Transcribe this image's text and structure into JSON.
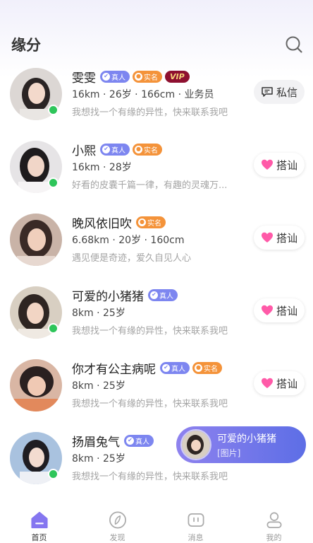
{
  "header": {
    "title": "缘分",
    "search_icon": "search-icon"
  },
  "users": [
    {
      "name": "雯雯",
      "badges": [
        "真人",
        "实名",
        "VIP"
      ],
      "info": "16km · 26岁 · 166cm · 业务员",
      "desc": "我想找一个有缘的异性，快来联系我吧",
      "online": true,
      "action": "私信",
      "action_icon": "message-icon"
    },
    {
      "name": "小熙",
      "badges": [
        "真人",
        "实名"
      ],
      "info": "16km · 28岁",
      "desc": "好看的皮囊千篇一律，有趣的灵魂万...",
      "online": true,
      "action": "搭讪",
      "action_icon": "heart-icon"
    },
    {
      "name": "晚风依旧吹",
      "badges": [
        "实名"
      ],
      "info": "6.68km · 20岁 · 160cm",
      "desc": "遇见便是奇迹，爱久自见人心",
      "online": false,
      "action": "搭讪",
      "action_icon": "heart-icon"
    },
    {
      "name": "可爱的小猪猪",
      "badges": [
        "真人"
      ],
      "info": "8km · 25岁",
      "desc": "我想找一个有缘的异性，快来联系我吧",
      "online": true,
      "action": "搭讪",
      "action_icon": "heart-icon"
    },
    {
      "name": "你才有公主病呢",
      "badges": [
        "真人",
        "实名"
      ],
      "info": "8km · 25岁",
      "desc": "我想找一个有缘的异性，快来联系我吧",
      "online": false,
      "action": "搭讪",
      "action_icon": "heart-icon"
    },
    {
      "name": "扬眉兔气",
      "badges": [
        "真人"
      ],
      "info": "8km · 25岁",
      "desc": "我想找一个有缘的异性，快来联系我吧",
      "online": true,
      "action": "",
      "action_icon": ""
    }
  ],
  "popup": {
    "name": "可爱的小猪猪",
    "text": "[图片]"
  },
  "tabs": [
    {
      "label": "首页",
      "icon": "home-icon",
      "active": true
    },
    {
      "label": "发现",
      "icon": "discover-icon",
      "active": false
    },
    {
      "label": "消息",
      "icon": "message-icon",
      "active": false
    },
    {
      "label": "我的",
      "icon": "profile-icon",
      "active": false
    }
  ],
  "colors": {
    "accent": "#7d7cf0",
    "real_badge": "#7d86f0",
    "verified_badge": "#f4933a",
    "vip_badge": "#8e1030",
    "online": "#2ec55a",
    "heart": "#ff5aa8"
  }
}
